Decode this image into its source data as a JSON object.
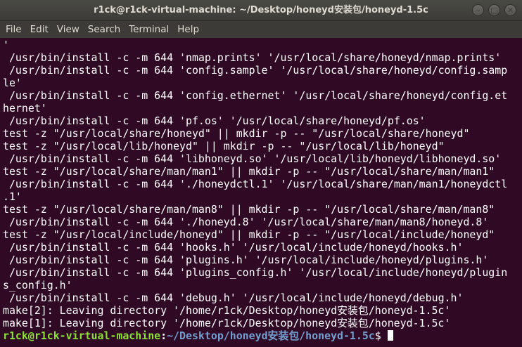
{
  "window": {
    "title": "r1ck@r1ck-virtual-machine: ~/Desktop/honeyd安装包/honeyd-1.5c",
    "minimize_glyph": "–",
    "maximize_glyph": "□",
    "close_glyph": "✕"
  },
  "menu": {
    "items": [
      {
        "label": "File"
      },
      {
        "label": "Edit"
      },
      {
        "label": "View"
      },
      {
        "label": "Search"
      },
      {
        "label": "Terminal"
      },
      {
        "label": "Help"
      }
    ]
  },
  "terminal": {
    "lines": [
      "'",
      " /usr/bin/install -c -m 644 'nmap.prints' '/usr/local/share/honeyd/nmap.prints'",
      " /usr/bin/install -c -m 644 'config.sample' '/usr/local/share/honeyd/config.samp",
      "le'",
      " /usr/bin/install -c -m 644 'config.ethernet' '/usr/local/share/honeyd/config.et",
      "hernet'",
      " /usr/bin/install -c -m 644 'pf.os' '/usr/local/share/honeyd/pf.os'",
      "test -z \"/usr/local/share/honeyd\" || mkdir -p -- \"/usr/local/share/honeyd\"",
      "test -z \"/usr/local/lib/honeyd\" || mkdir -p -- \"/usr/local/lib/honeyd\"",
      " /usr/bin/install -c -m 644 'libhoneyd.so' '/usr/local/lib/honeyd/libhoneyd.so'",
      "test -z \"/usr/local/share/man/man1\" || mkdir -p -- \"/usr/local/share/man/man1\"",
      " /usr/bin/install -c -m 644 './honeydctl.1' '/usr/local/share/man/man1/honeydctl",
      ".1'",
      "test -z \"/usr/local/share/man/man8\" || mkdir -p -- \"/usr/local/share/man/man8\"",
      " /usr/bin/install -c -m 644 './honeyd.8' '/usr/local/share/man/man8/honeyd.8'",
      "test -z \"/usr/local/include/honeyd\" || mkdir -p -- \"/usr/local/include/honeyd\"",
      " /usr/bin/install -c -m 644 'hooks.h' '/usr/local/include/honeyd/hooks.h'",
      " /usr/bin/install -c -m 644 'plugins.h' '/usr/local/include/honeyd/plugins.h'",
      " /usr/bin/install -c -m 644 'plugins_config.h' '/usr/local/include/honeyd/plugin",
      "s_config.h'",
      " /usr/bin/install -c -m 644 'debug.h' '/usr/local/include/honeyd/debug.h'",
      "make[2]: Leaving directory '/home/r1ck/Desktop/honeyd安装包/honeyd-1.5c'",
      "make[1]: Leaving directory '/home/r1ck/Desktop/honeyd安装包/honeyd-1.5c'"
    ],
    "prompt": {
      "user_host": "r1ck@r1ck-virtual-machine",
      "colon": ":",
      "path": "~/Desktop/honeyd安装包/honeyd-1.5c",
      "symbol": "$ "
    },
    "colors": {
      "background": "#300a24",
      "text": "#ffffff",
      "prompt_user": "#8ae234",
      "prompt_path": "#729fcf"
    }
  }
}
